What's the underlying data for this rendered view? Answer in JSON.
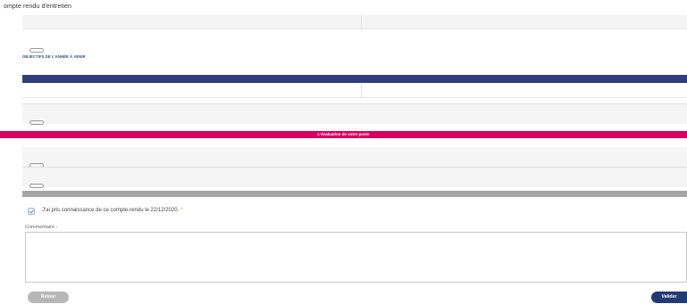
{
  "page": {
    "title": "ompte rendu d'entretien"
  },
  "previous_section": {
    "synthesis_label": "",
    "synthesis_pill": "",
    "synthesis_value": ""
  },
  "objectives": {
    "heading": "OBJECTIFS DE L'ANNÉE À VENIR",
    "columns": [
      "",
      ""
    ],
    "rows": [
      {
        "objective_line1": "",
        "objective_line2": "",
        "deadline": ""
      }
    ],
    "synthesis_label": "",
    "synthesis_pill": "",
    "synthesis_value": ""
  },
  "post_evaluation": {
    "banner": "L'évaluation de votre poste",
    "intro": "",
    "strengths_label": "",
    "strengths_pill": "",
    "strengths_value": "",
    "improvements_label": "",
    "improvements_pill": "",
    "improvements_value": ""
  },
  "skills_banner": "",
  "acknowledgement": {
    "checked": true,
    "text": "J'ai pris connaissance de ce compte-rendu le 22/12/2020.",
    "required_mark": "*"
  },
  "comment": {
    "label": "Commentaire :",
    "value": ""
  },
  "buttons": {
    "back": "Retour",
    "submit": "Valider"
  },
  "colors": {
    "header_navy": "#2f3e7a",
    "banner_pink": "#d6005e",
    "banner_grey": "#a5a5a5",
    "submit_navy": "#233a73",
    "back_grey": "#b7b7b7",
    "required_star": "#e8a300"
  }
}
